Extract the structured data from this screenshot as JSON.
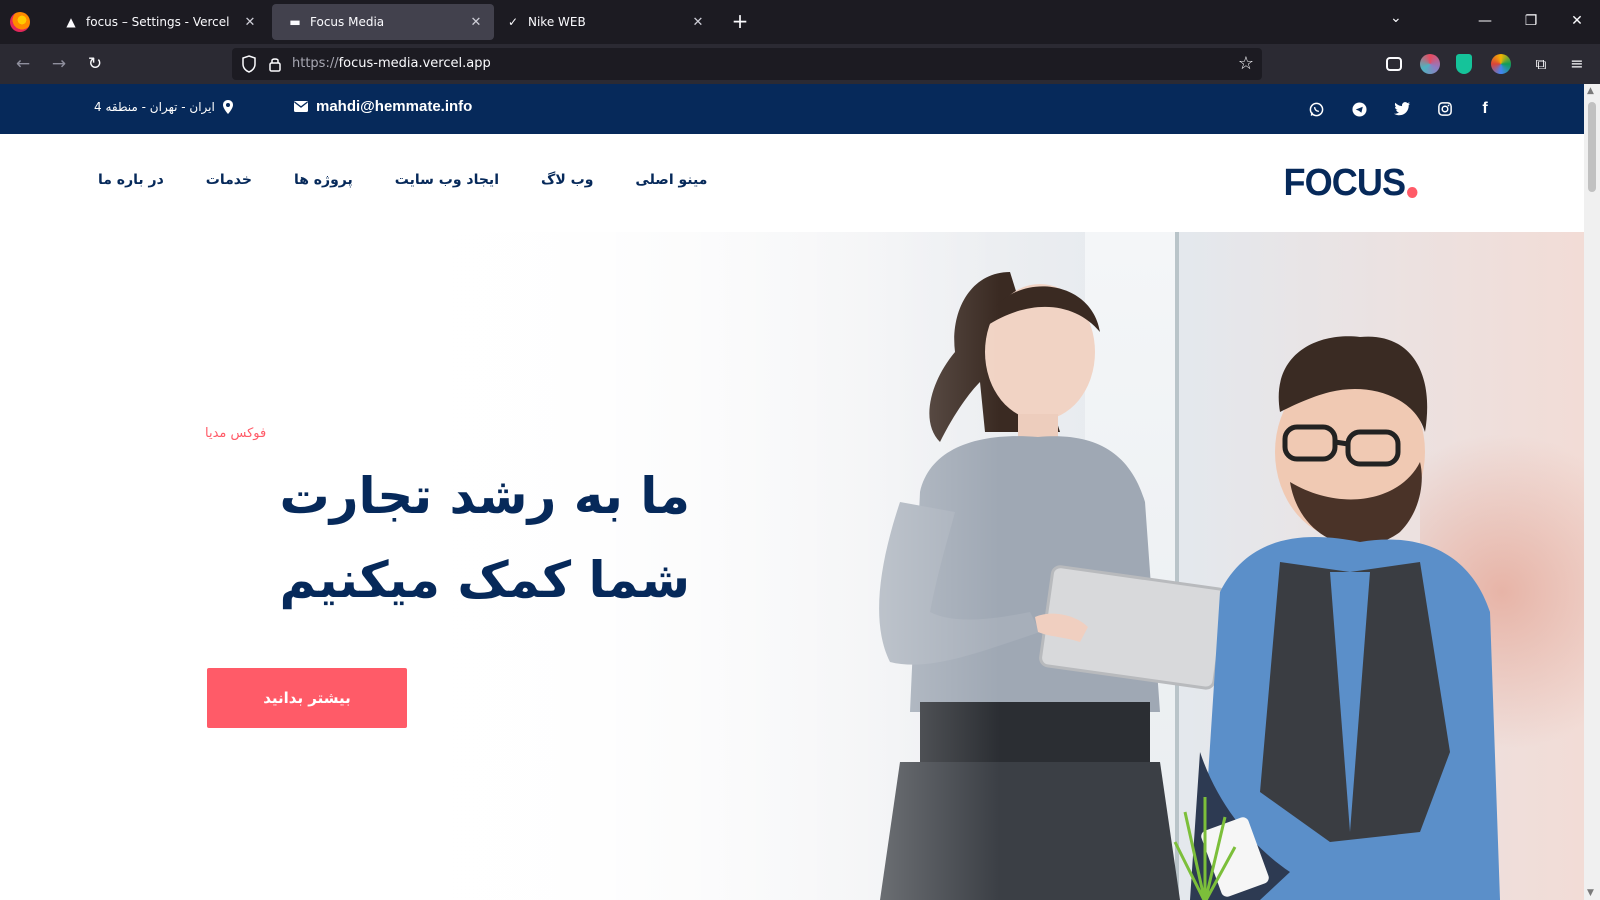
{
  "browser": {
    "tabs": [
      {
        "label": "focus – Settings - Vercel",
        "active": false
      },
      {
        "label": "Focus Media",
        "active": true
      },
      {
        "label": "Nike WEB",
        "active": false
      }
    ],
    "url_protocol": "https://",
    "url_host": "focus-media.vercel.app"
  },
  "topbar": {
    "address": "ایران - تهران - منطقه 4",
    "email": "mahdi@hemmate.info",
    "social": [
      "whatsapp-icon",
      "telegram-icon",
      "twitter-icon",
      "instagram-icon",
      "facebook-icon"
    ]
  },
  "nav": {
    "logo": "FOCUS",
    "items": [
      "مینو اصلی",
      "وب لاگ",
      "ایجاد وب سایت",
      "پروژه ها",
      "خدمات",
      "در باره ما"
    ]
  },
  "hero": {
    "kicker": "فوکس مدیا",
    "title": "ما به رشد تجارت شما کمک میکنیم",
    "button": "بیشتر بدانید"
  },
  "colors": {
    "brand_navy": "#06295a",
    "accent": "#ff5b68"
  }
}
